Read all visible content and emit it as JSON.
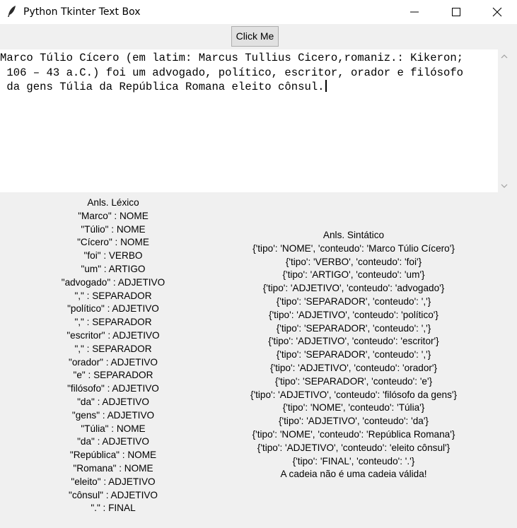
{
  "window": {
    "title": "Python Tkinter Text Box",
    "icon": "feather-icon",
    "controls": [
      "minimize-icon",
      "maximize-icon",
      "close-icon"
    ]
  },
  "toolbar": {
    "click_label": "Click Me"
  },
  "text_box": {
    "lines": [
      "Marco Túlio Cícero (em latim: Marcus Tullius Cicero,romaniz.: Kikeron;",
      " 106 – 43 a.C.) foi um advogado, político, escritor, orador e filósofo",
      " da gens Túlia da República Romana eleito cônsul."
    ]
  },
  "lexico": {
    "title": "Anls. Léxico",
    "items": [
      "\"Marco\" : NOME",
      "\"Túlio\" : NOME",
      "\"Cícero\" : NOME",
      "\"foi\" : VERBO",
      "\"um\" : ARTIGO",
      "\"advogado\" : ADJETIVO",
      "\",\" : SEPARADOR",
      "\"político\" : ADJETIVO",
      "\",\" : SEPARADOR",
      "\"escritor\" : ADJETIVO",
      "\",\" : SEPARADOR",
      "\"orador\" : ADJETIVO",
      "\"e\" : SEPARADOR",
      "\"filósofo\" : ADJETIVO",
      "\"da\" : ADJETIVO",
      "\"gens\" : ADJETIVO",
      "\"Túlia\" : NOME",
      "\"da\" : ADJETIVO",
      "\"República\" : NOME",
      "\"Romana\" : NOME",
      "\"eleito\" : ADJETIVO",
      "\"cônsul\" : ADJETIVO",
      "\".\" : FINAL"
    ]
  },
  "sintatico": {
    "title": "Anls. Sintático",
    "items": [
      "{'tipo': 'NOME', 'conteudo': 'Marco Túlio Cícero'}",
      "{'tipo': 'VERBO', 'conteudo': 'foi'}",
      "{'tipo': 'ARTIGO', 'conteudo': 'um'}",
      "{'tipo': 'ADJETIVO', 'conteudo': 'advogado'}",
      "{'tipo': 'SEPARADOR', 'conteudo': ','}",
      "{'tipo': 'ADJETIVO', 'conteudo': 'político'}",
      "{'tipo': 'SEPARADOR', 'conteudo': ','}",
      "{'tipo': 'ADJETIVO', 'conteudo': 'escritor'}",
      "{'tipo': 'SEPARADOR', 'conteudo': ','}",
      "{'tipo': 'ADJETIVO', 'conteudo': 'orador'}",
      "{'tipo': 'SEPARADOR', 'conteudo': 'e'}",
      "{'tipo': 'ADJETIVO', 'conteudo': 'filósofo da gens'}",
      "{'tipo': 'NOME', 'conteudo': 'Túlia'}",
      "{'tipo': 'ADJETIVO', 'conteudo': 'da'}",
      "{'tipo': 'NOME', 'conteudo': 'República Romana'}",
      "{'tipo': 'ADJETIVO', 'conteudo': 'eleito cônsul'}",
      "{'tipo': 'FINAL', 'conteudo': '.'}"
    ],
    "result": "A cadeia não é uma cadeia válida!"
  }
}
